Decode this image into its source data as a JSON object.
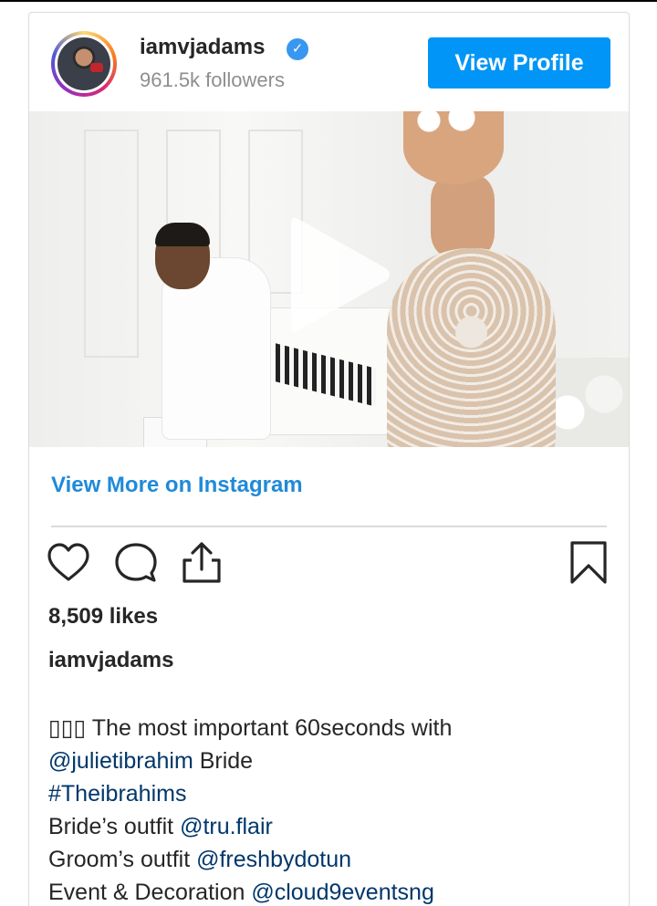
{
  "profile": {
    "username": "iamvjadams",
    "verified": true,
    "followers": "961.5k followers",
    "view_profile_label": "View Profile"
  },
  "media": {
    "type": "video",
    "play_icon": "play-icon"
  },
  "links": {
    "view_more": "View More on Instagram"
  },
  "actions": {
    "icons": [
      "heart-icon",
      "comment-icon",
      "share-icon",
      "bookmark-icon"
    ]
  },
  "post": {
    "likes": "8,509 likes",
    "author": "iamvjadams",
    "caption": [
      {
        "text": "▯▯▯ The most important 60seconds with",
        "mention": ""
      },
      {
        "mention": "@julietibrahim",
        "text": " Bride"
      },
      {
        "mention": "#Theibrahims",
        "text": ""
      },
      {
        "text": "Bride’s outfit ",
        "mention": "@tru.flair"
      },
      {
        "text": "Groom’s outfit ",
        "mention": "@freshbydotun"
      },
      {
        "text": "Event & Decoration ",
        "mention": "@cloud9eventsng"
      }
    ]
  },
  "colors": {
    "accent": "#0095f6",
    "link": "#1f8ad8",
    "mention": "#00376b",
    "muted": "#8e8e8e",
    "verified": "#3897f0"
  }
}
